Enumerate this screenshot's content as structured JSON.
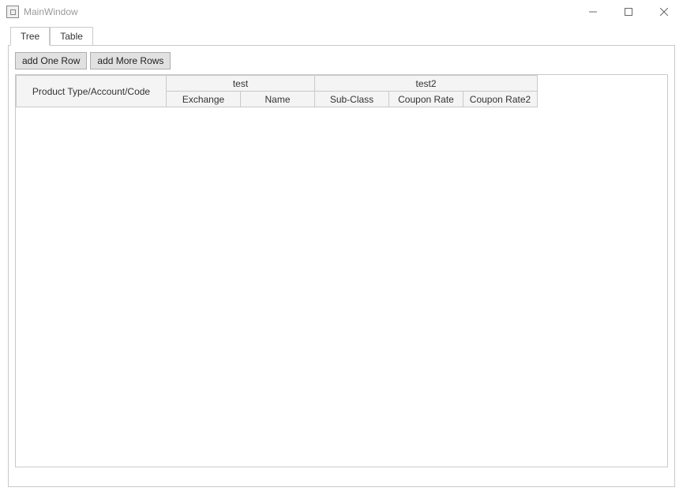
{
  "window": {
    "title": "MainWindow"
  },
  "tabs": {
    "tree": "Tree",
    "table": "Table"
  },
  "toolbar": {
    "add_one": "add One Row",
    "add_more": "add More Rows"
  },
  "table": {
    "header": {
      "product": "Product Type/Account/Code",
      "group1": "test",
      "group2": "test2",
      "exchange": "Exchange",
      "name_col": "Name",
      "subclass": "Sub-Class",
      "coupon_rate": "Coupon Rate",
      "coupon_rate2": "Coupon Rate2"
    },
    "rows": []
  }
}
